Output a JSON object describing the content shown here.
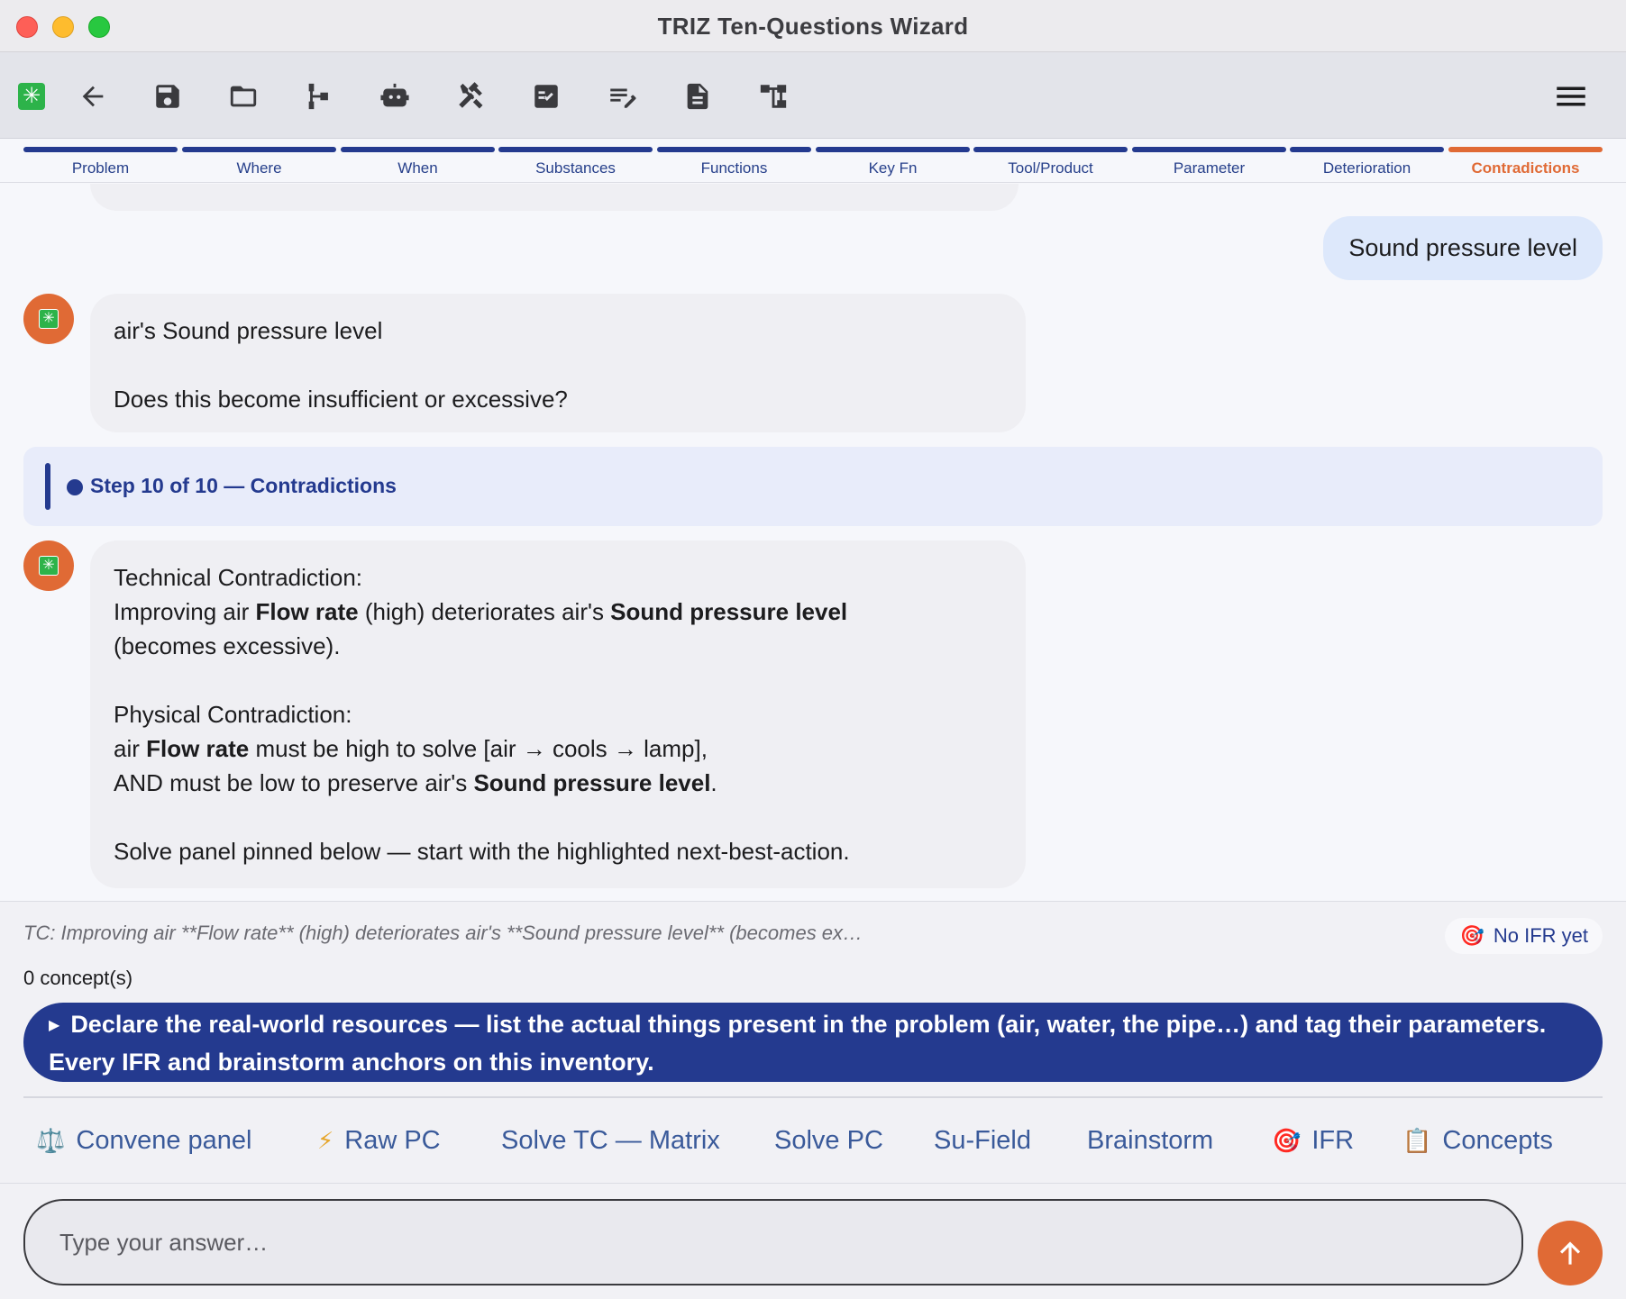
{
  "window": {
    "title": "TRIZ Ten-Questions Wizard"
  },
  "toolbar": {
    "logo_glyph": "✳",
    "buttons": [
      "back-icon",
      "save-icon",
      "folder-icon",
      "tree-icon",
      "robot-icon",
      "tools-icon",
      "checklist-icon",
      "edit-notes-icon",
      "document-icon",
      "hierarchy-icon"
    ],
    "menu_icon": "hamburger-icon"
  },
  "tabs": [
    {
      "label": "Problem",
      "active": false
    },
    {
      "label": "Where",
      "active": false
    },
    {
      "label": "When",
      "active": false
    },
    {
      "label": "Substances",
      "active": false
    },
    {
      "label": "Functions",
      "active": false
    },
    {
      "label": "Key Fn",
      "active": false
    },
    {
      "label": "Tool/Product",
      "active": false
    },
    {
      "label": "Parameter",
      "active": false
    },
    {
      "label": "Deterioration",
      "active": false
    },
    {
      "label": "Contradictions",
      "active": true
    }
  ],
  "chat": {
    "user_message": "Sound pressure level",
    "bot_message_1": {
      "line1": "air's Sound pressure level",
      "line2": "Does this become insufficient or excessive?"
    },
    "step_banner": "Step 10 of 10 — Contradictions",
    "bot_message_2": {
      "tc_heading": "Technical Contradiction:",
      "tc_a": "Improving air ",
      "tc_b": "Flow rate",
      "tc_c": " (high) deteriorates air's ",
      "tc_d": "Sound pressure level",
      "tc_e": "(becomes excessive).",
      "pc_heading": "Physical Contradiction:",
      "pc_a": "air ",
      "pc_b": "Flow rate",
      "pc_c": " must be high to solve [air → cools → lamp],",
      "pc_d": "AND must be low to preserve air's ",
      "pc_e": "Sound pressure level",
      "pc_f": ".",
      "closing": "Solve panel pinned below — start with the highlighted next-best-action."
    }
  },
  "panel": {
    "tc_summary": "TC: Improving air **Flow rate** (high) deteriorates air's **Sound pressure level** (becomes ex…",
    "ifr_chip": "No IFR yet",
    "concept_count": "0 concept(s)",
    "next_best_action": "Declare the real-world resources — list the actual things present in the problem (air, water, the pipe…) and tag their parameters. Every IFR and brainstorm anchors on this inventory.",
    "actions": [
      {
        "label": "Convene panel",
        "icon": "⚖️"
      },
      {
        "label": "Raw PC",
        "icon": "⚡"
      },
      {
        "label": "Solve TC — Matrix",
        "icon": ""
      },
      {
        "label": "Solve PC",
        "icon": ""
      },
      {
        "label": "Su-Field",
        "icon": ""
      },
      {
        "label": "Brainstorm",
        "icon": ""
      },
      {
        "label": "IFR",
        "icon": "🎯"
      },
      {
        "label": "Concepts",
        "icon": "📋"
      }
    ],
    "input_placeholder": "Type your answer…"
  },
  "colors": {
    "accent_orange": "#e06a35",
    "accent_navy": "#243a8f",
    "user_bubble": "#dde8fb",
    "bot_bubble": "#efeff3"
  }
}
